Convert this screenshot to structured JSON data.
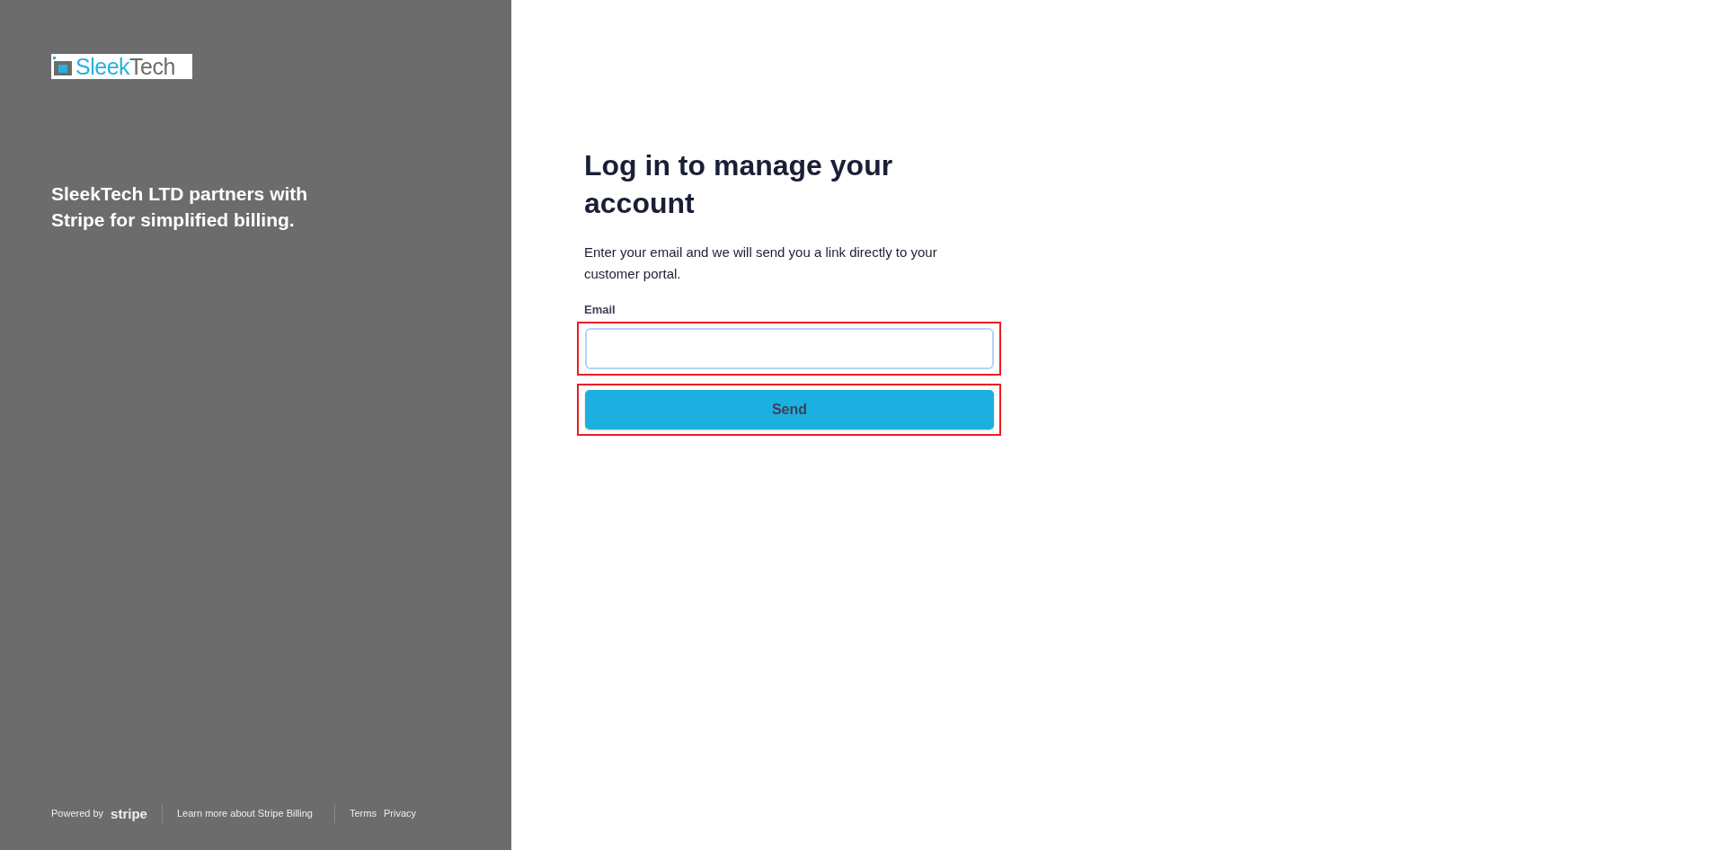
{
  "brand": {
    "logo_parts": [
      "Sleek",
      "Tech"
    ],
    "tagline": "SleekTech LTD partners with Stripe for simplified billing."
  },
  "footer": {
    "powered_by": "Powered by",
    "stripe_wordmark": "stripe",
    "links": [
      "Learn more about Stripe Billing",
      "Terms",
      "Privacy"
    ]
  },
  "form": {
    "title": "Log in to manage your account",
    "description": "Enter your email and we will send you a link directly to your customer portal.",
    "email_label": "Email",
    "submit": "Send",
    "highlighted": true
  }
}
